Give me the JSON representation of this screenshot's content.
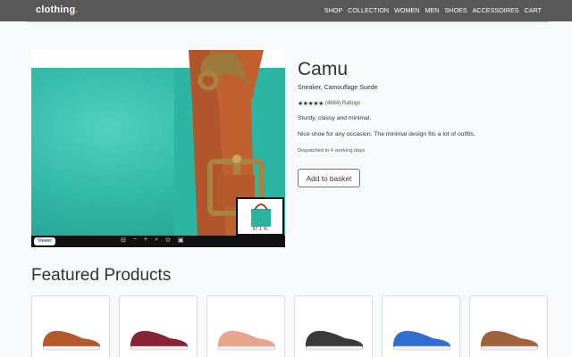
{
  "nav": {
    "brand": "clothing",
    "brand_dot": ".",
    "links": [
      "SHOP",
      "COLLECTION",
      "WOMEN",
      "MEN",
      "SHOES",
      "ACCESSOIRES",
      "CART"
    ]
  },
  "viewer": {
    "badge": "Viewer",
    "zoom_percent": "57.1 %",
    "tools": [
      "⊟",
      "−",
      "+",
      "⌕",
      "⊙",
      "▣"
    ]
  },
  "product": {
    "title": "Camu",
    "subtitle": "Sneaker, Camouflage Suede",
    "stars": "★★★★★",
    "rating_text": "(4664) Ratings",
    "desc1": "Sturdy, classy and minimal.",
    "desc2": "Nice shoe for any occasion. The minimal design fits a lot of outfits.",
    "dispatch": "Dispatched in 4 working days",
    "add_button": "Add to basket"
  },
  "featured": {
    "heading": "Featured Products",
    "items": [
      {
        "color": "#b5582c"
      },
      {
        "color": "#8a2236"
      },
      {
        "color": "#e8a48c"
      },
      {
        "color": "#3a3a3a"
      },
      {
        "color": "#2f6fd0"
      },
      {
        "color": "#a0623c"
      }
    ]
  }
}
